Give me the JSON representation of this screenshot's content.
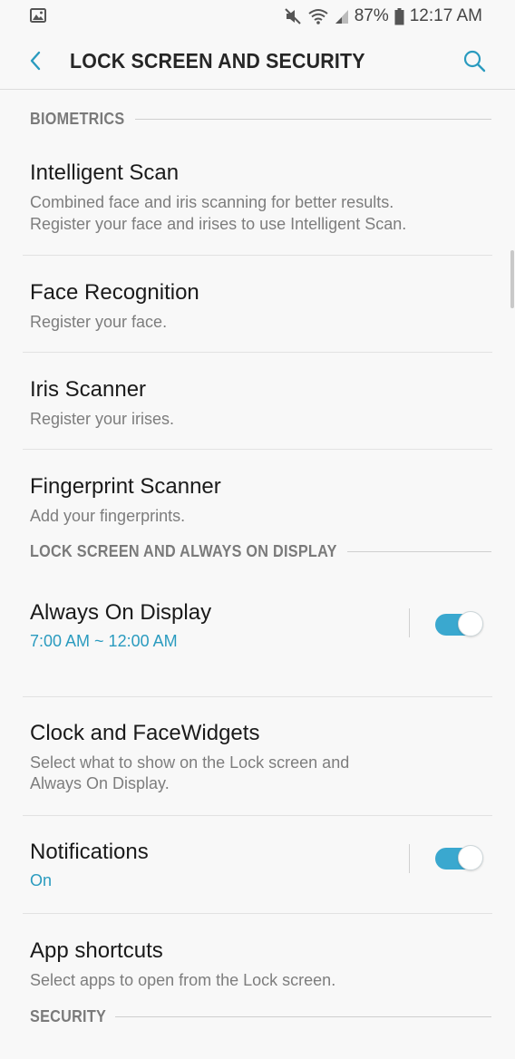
{
  "status_bar": {
    "battery": "87%",
    "time": "12:17 AM",
    "icons": [
      "gallery-notification-icon",
      "mute-icon",
      "wifi-icon",
      "signal-icon",
      "battery-icon"
    ]
  },
  "app_bar": {
    "title": "LOCK SCREEN AND SECURITY",
    "back_icon": "chevron-left-icon",
    "search_icon": "search-icon"
  },
  "sections": {
    "biometrics": {
      "header": "BIOMETRICS",
      "items": [
        {
          "title": "Intelligent Scan",
          "subtitle": [
            "Combined face and iris scanning for better results.",
            "Register your face and irises to use Intelligent Scan."
          ]
        },
        {
          "title": "Face Recognition",
          "subtitle": [
            "Register your face."
          ]
        },
        {
          "title": "Iris Scanner",
          "subtitle": [
            "Register your irises."
          ]
        },
        {
          "title": "Fingerprint Scanner",
          "subtitle": [
            "Add your fingerprints."
          ]
        }
      ]
    },
    "lock_screen": {
      "header": "LOCK SCREEN AND ALWAYS ON DISPLAY",
      "items": [
        {
          "title": "Always On Display",
          "subtitle": [
            "7:00 AM ~ 12:00 AM"
          ],
          "toggle": true
        },
        {
          "title": "Clock and FaceWidgets",
          "subtitle": [
            "Select what to show on the Lock screen and",
            "Always On Display."
          ]
        },
        {
          "title": "Notifications",
          "subtitle": [
            "On"
          ],
          "toggle": true
        },
        {
          "title": "App shortcuts",
          "subtitle": [
            "Select apps to open from the Lock screen."
          ]
        }
      ]
    },
    "security": {
      "header": "SECURITY"
    }
  },
  "colors": {
    "accent": "#2a9bbf",
    "toggle_on": "#3aa8cf",
    "background": "#f8f8f8"
  }
}
